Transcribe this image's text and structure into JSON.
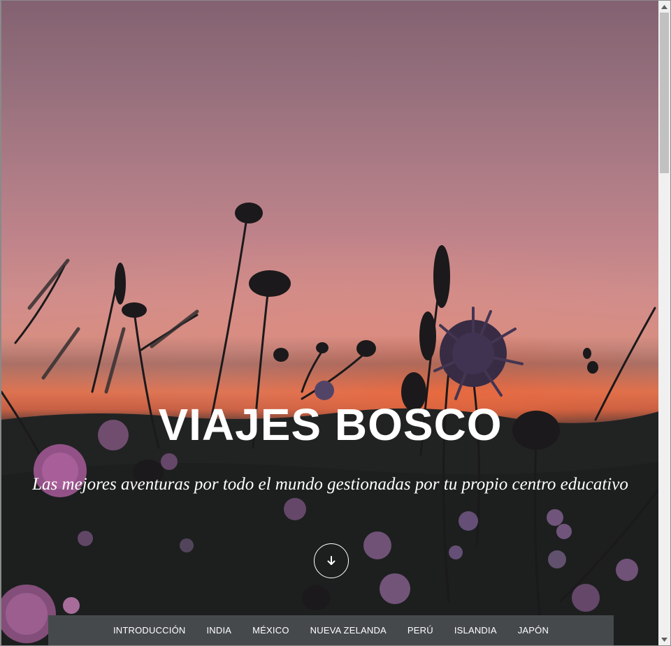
{
  "hero": {
    "title": "VIAJES BOSCO",
    "subtitle": "Las mejores aventuras por todo el mundo gestionadas por tu propio centro educativo",
    "scroll_icon": "arrow-down-icon"
  },
  "nav": {
    "items": [
      {
        "label": "INTRODUCCIÓN"
      },
      {
        "label": "INDIA"
      },
      {
        "label": "MÉXICO"
      },
      {
        "label": "NUEVA ZELANDA"
      },
      {
        "label": "PERÚ"
      },
      {
        "label": "ISLANDIA"
      },
      {
        "label": "JAPÓN"
      }
    ]
  },
  "scrollbar": {
    "up_icon": "scroll-up-arrow-icon",
    "down_icon": "scroll-down-arrow-icon"
  },
  "colors": {
    "nav_background": "#46494c",
    "text": "#ffffff",
    "sky_top": "#8f6a7a",
    "sunset_glow": "#f17d58"
  }
}
